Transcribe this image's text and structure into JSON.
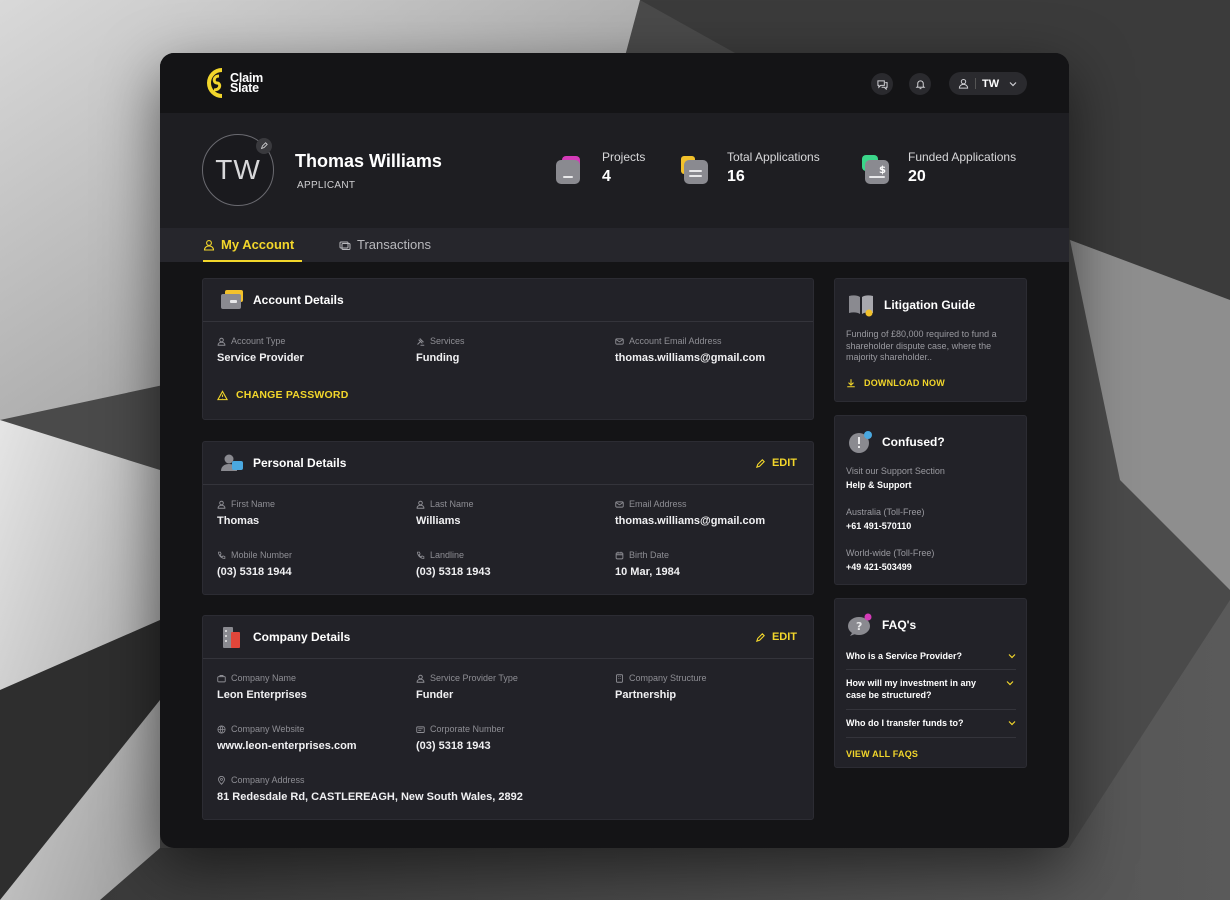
{
  "brand": {
    "name_line1": "Claim",
    "name_line2": "Slate",
    "accent": "#f2d62b"
  },
  "topbar": {
    "user_initials": "TW"
  },
  "profile": {
    "initials": "TW",
    "name": "Thomas Williams",
    "role": "APPLICANT",
    "stats": [
      {
        "label": "Projects",
        "value": "4",
        "icon": "folder-icon"
      },
      {
        "label": "Total Applications",
        "value": "16",
        "icon": "document-stack-icon"
      },
      {
        "label": "Funded Applications",
        "value": "20",
        "icon": "dollar-document-icon"
      }
    ]
  },
  "tabs": [
    {
      "label": "My Account",
      "active": true
    },
    {
      "label": "Transactions",
      "active": false
    }
  ],
  "account_details": {
    "title": "Account Details",
    "fields": [
      {
        "label": "Account Type",
        "value": "Service Provider"
      },
      {
        "label": "Services",
        "value": "Funding"
      },
      {
        "label": "Account Email Address",
        "value": "thomas.williams@gmail.com"
      }
    ],
    "change_password": "CHANGE PASSWORD"
  },
  "personal_details": {
    "title": "Personal Details",
    "edit": "EDIT",
    "fields": [
      {
        "label": "First Name",
        "value": "Thomas"
      },
      {
        "label": "Last Name",
        "value": "Williams"
      },
      {
        "label": "Email Address",
        "value": "thomas.williams@gmail.com"
      },
      {
        "label": "Mobile Number",
        "value": "(03) 5318 1944"
      },
      {
        "label": "Landline",
        "value": "(03) 5318 1943"
      },
      {
        "label": "Birth Date",
        "value": "10 Mar, 1984"
      }
    ]
  },
  "company_details": {
    "title": "Company Details",
    "edit": "EDIT",
    "fields": [
      {
        "label": "Company Name",
        "value": "Leon Enterprises"
      },
      {
        "label": "Service Provider Type",
        "value": "Funder"
      },
      {
        "label": "Company Structure",
        "value": "Partnership"
      },
      {
        "label": "Company Website",
        "value": "www.leon-enterprises.com"
      },
      {
        "label": "Corporate Number",
        "value": "(03) 5318 1943"
      },
      {
        "label": "Company Address",
        "value": "81 Redesdale Rd, CASTLEREAGH, New South Wales, 2892"
      }
    ]
  },
  "litigation_guide": {
    "title": "Litigation Guide",
    "description": "Funding of £80,000 required to fund a shareholder dispute case, where the majority shareholder..",
    "download": "DOWNLOAD NOW"
  },
  "confused": {
    "title": "Confused?",
    "support_label": "Visit our Support Section",
    "support_link": "Help & Support",
    "australia_label": "Australia (Toll-Free)",
    "australia_phone": "+61 491-570110",
    "world_label": "World-wide (Toll-Free)",
    "world_phone": "+49 421-503499"
  },
  "faqs": {
    "title": "FAQ's",
    "items": [
      "Who is a Service Provider?",
      "How will my investment in any case be structured?",
      "Who do I transfer funds to?"
    ],
    "view_all": "VIEW ALL FAQS"
  }
}
